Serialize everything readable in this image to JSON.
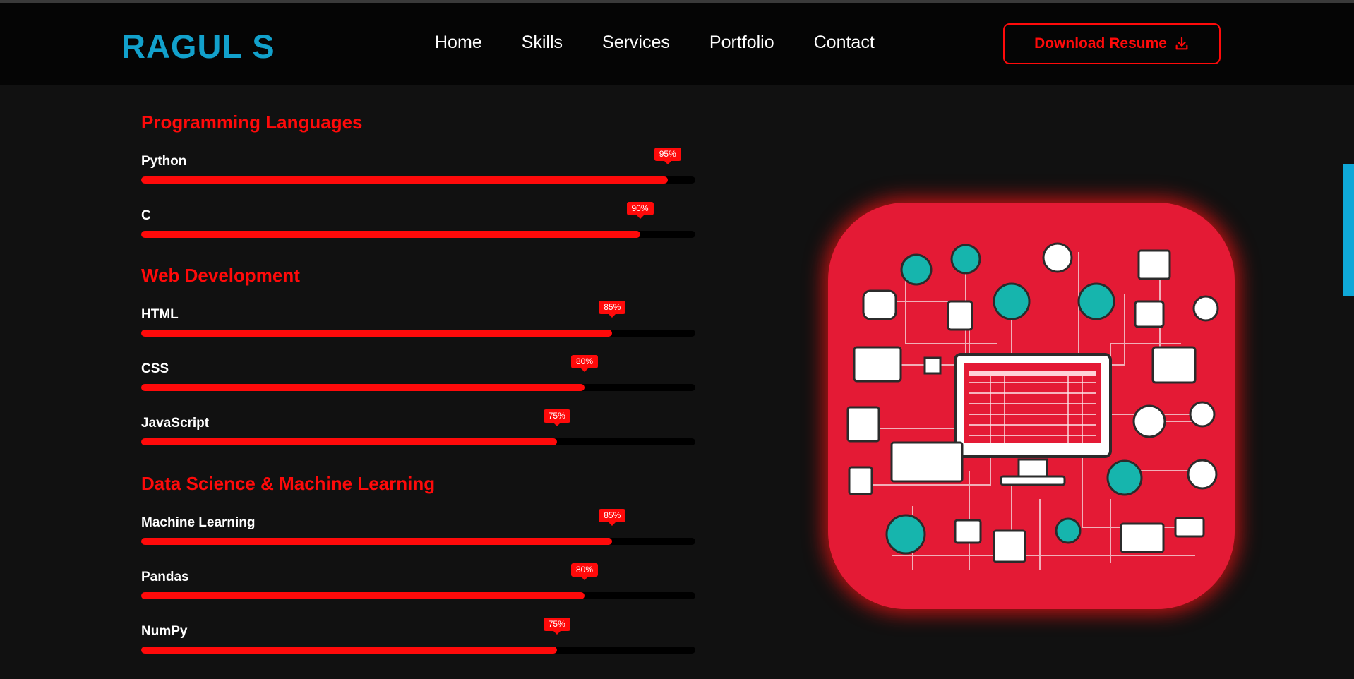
{
  "brand": {
    "name": "RAGUL S",
    "color": "#12a1cc",
    "accent": "#ff0a0a"
  },
  "nav": {
    "links": [
      {
        "label": "Home"
      },
      {
        "label": "Skills"
      },
      {
        "label": "Services"
      },
      {
        "label": "Portfolio"
      },
      {
        "label": "Contact"
      }
    ],
    "download_label": "Download Resume",
    "download_icon": "download-icon"
  },
  "skills": {
    "sections": [
      {
        "title": "Programming Languages",
        "items": [
          {
            "name": "Python",
            "percent_label": "95%",
            "value": 0.95
          },
          {
            "name": "C",
            "percent_label": "90%",
            "value": 0.9
          }
        ]
      },
      {
        "title": "Web Development",
        "items": [
          {
            "name": "HTML",
            "percent_label": "85%",
            "value": 0.85
          },
          {
            "name": "CSS",
            "percent_label": "80%",
            "value": 0.8
          },
          {
            "name": "JavaScript",
            "percent_label": "75%",
            "value": 0.75
          }
        ]
      },
      {
        "title": "Data Science & Machine Learning",
        "items": [
          {
            "name": "Machine Learning",
            "percent_label": "85%",
            "value": 0.85
          },
          {
            "name": "Pandas",
            "percent_label": "80%",
            "value": 0.8
          },
          {
            "name": "NumPy",
            "percent_label": "75%",
            "value": 0.75
          }
        ]
      }
    ]
  },
  "illustration": {
    "icon": "computer-network-illustration"
  }
}
